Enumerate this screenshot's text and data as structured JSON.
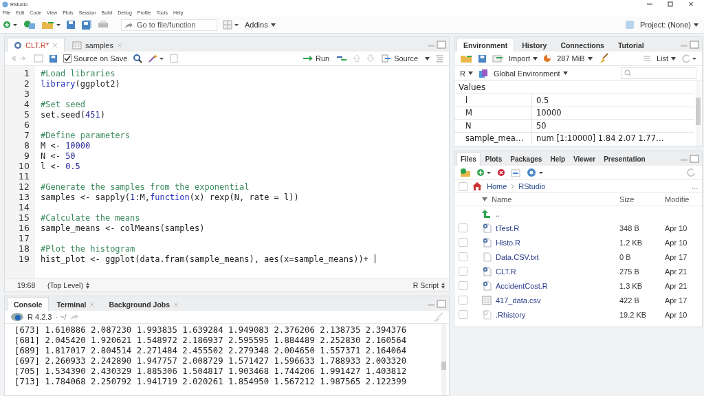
{
  "window": {
    "title": "RStudio"
  },
  "menu": [
    "File",
    "Edit",
    "Code",
    "View",
    "Plots",
    "Session",
    "Build",
    "Debug",
    "Profile",
    "Tools",
    "Help"
  ],
  "toolbar": {
    "goto_placeholder": "Go to file/function",
    "addins": "Addins",
    "project": "Project: (None)"
  },
  "editor": {
    "tabs": [
      {
        "label": "CLT.R*",
        "kind": "script",
        "selected": true,
        "modified": true
      },
      {
        "label": "samples",
        "kind": "table",
        "selected": false,
        "modified": false
      }
    ],
    "source_on_save": {
      "label": "Source on Save",
      "checked": true
    },
    "run": "Run",
    "source": "Source",
    "lines": [
      {
        "number": "1",
        "segments": [
          {
            "kind": "comment",
            "text": "#Load libraries"
          }
        ]
      },
      {
        "number": "2",
        "segments": [
          {
            "kind": "keyword",
            "text": "library"
          },
          {
            "kind": "plain",
            "text": "(ggplot2)"
          }
        ]
      },
      {
        "number": "3"
      },
      {
        "number": "4",
        "segments": [
          {
            "kind": "comment",
            "text": "#Set seed"
          }
        ]
      },
      {
        "number": "5",
        "segments": [
          {
            "kind": "plain",
            "text": "set.seed("
          },
          {
            "kind": "number",
            "text": "451"
          },
          {
            "kind": "plain",
            "text": ")"
          }
        ]
      },
      {
        "number": "6"
      },
      {
        "number": "7",
        "segments": [
          {
            "kind": "comment",
            "text": "#Define parameters"
          }
        ]
      },
      {
        "number": "8",
        "segments": [
          {
            "kind": "plain",
            "text": "M <- "
          },
          {
            "kind": "number",
            "text": "10000"
          }
        ]
      },
      {
        "number": "9",
        "segments": [
          {
            "kind": "plain",
            "text": "N <- "
          },
          {
            "kind": "number",
            "text": "50"
          }
        ]
      },
      {
        "number": "10",
        "segments": [
          {
            "kind": "plain",
            "text": "l <- "
          },
          {
            "kind": "number",
            "text": "0.5"
          }
        ]
      },
      {
        "number": "11"
      },
      {
        "number": "12",
        "segments": [
          {
            "kind": "comment",
            "text": "#Generate the samples from the exponential"
          }
        ]
      },
      {
        "number": "13",
        "segments": [
          {
            "kind": "plain",
            "text": "samples <- sapply("
          },
          {
            "kind": "number",
            "text": "1"
          },
          {
            "kind": "plain",
            "text": ":M,"
          },
          {
            "kind": "keyword",
            "text": "function"
          },
          {
            "kind": "plain",
            "text": "(x) rexp(N, rate = l))"
          }
        ]
      },
      {
        "number": "14"
      },
      {
        "number": "15",
        "segments": [
          {
            "kind": "comment",
            "text": "#Calculate the means"
          }
        ]
      },
      {
        "number": "16",
        "segments": [
          {
            "kind": "plain",
            "text": "sample_means <- colMeans(samples)"
          }
        ]
      },
      {
        "number": "17"
      },
      {
        "number": "18",
        "segments": [
          {
            "kind": "comment",
            "text": "#Plot the histogram"
          }
        ]
      },
      {
        "number": "19",
        "segments": [
          {
            "kind": "plain",
            "text": "hist_plot <- ggplot(data.fram(sample_means), aes(x=sample_means))+ "
          }
        ],
        "cursor": true
      }
    ],
    "status": {
      "position": "19:68",
      "scope": "(Top Level)",
      "file_type": "R Script"
    }
  },
  "console": {
    "tabs": [
      {
        "label": "Console",
        "selected": true,
        "closable": false
      },
      {
        "label": "Terminal",
        "selected": false,
        "closable": true
      },
      {
        "label": "Background Jobs",
        "selected": false,
        "closable": true
      }
    ],
    "version": "R 4.2.3",
    "path": "· ~/",
    "output": [
      "[673] 1.610886 2.087230 1.993835 1.639284 1.949083 2.376206 2.138735 2.394376",
      "[681] 2.045420 1.920621 1.548972 2.186937 2.595595 1.884489 2.252830 2.160564",
      "[689] 1.817017 2.804514 2.271484 2.455502 2.279348 2.004650 1.557371 2.164064",
      "[697] 2.260933 2.242890 1.947757 2.008729 1.571427 1.596633 1.788933 2.003320",
      "[705] 1.534390 2.430329 1.885306 1.504817 1.903468 1.744206 1.991427 1.403812",
      "[713] 1.784068 2.250792 1.941719 2.020261 1.854950 1.567212 1.987565 2.122399"
    ]
  },
  "environment": {
    "tabs": [
      {
        "label": "Environment",
        "selected": true
      },
      {
        "label": "History",
        "selected": false
      },
      {
        "label": "Connections",
        "selected": false
      },
      {
        "label": "Tutorial",
        "selected": false
      }
    ],
    "import": "Import",
    "memory": "287 MiB",
    "view": "List",
    "language": "R",
    "scope": "Global Environment",
    "section": "Values",
    "values": [
      {
        "name": "l",
        "value": "0.5"
      },
      {
        "name": "M",
        "value": "10000"
      },
      {
        "name": "N",
        "value": "50"
      },
      {
        "name": "sample_mea…",
        "value": "num [1:10000] 1.84 2.07 1.77…"
      }
    ]
  },
  "files": {
    "tabs": [
      {
        "label": "Files",
        "selected": true
      },
      {
        "label": "Plots",
        "selected": false
      },
      {
        "label": "Packages",
        "selected": false
      },
      {
        "label": "Help",
        "selected": false
      },
      {
        "label": "Viewer",
        "selected": false
      },
      {
        "label": "Presentation",
        "selected": false
      }
    ],
    "select_all": {
      "checked": false
    },
    "breadcrumb": [
      "Home",
      "RStudio"
    ],
    "more": "...",
    "columns": [
      "Name",
      "Size",
      "Modifie"
    ],
    "parent": "..",
    "rows": [
      {
        "kind": "r-script",
        "name": "tTest.R",
        "size": "348 B",
        "modified": "Apr 10",
        "checked": false
      },
      {
        "kind": "r-script",
        "name": "Histo.R",
        "size": "1.2 KB",
        "modified": "Apr 10",
        "checked": false
      },
      {
        "kind": "text",
        "name": "Data.CSV.txt",
        "size": "0 B",
        "modified": "Apr 17",
        "checked": false
      },
      {
        "kind": "r-script",
        "name": "CLT.R",
        "size": "275 B",
        "modified": "Apr 21",
        "checked": false
      },
      {
        "kind": "r-script",
        "name": "AccidentCost.R",
        "size": "1.3 KB",
        "modified": "Apr 21",
        "checked": false
      },
      {
        "kind": "table",
        "name": "417_data.csv",
        "size": "422 B",
        "modified": "Apr 17",
        "checked": false
      },
      {
        "kind": "history",
        "name": ".Rhistory",
        "size": "19.2 KB",
        "modified": "Apr 10",
        "checked": false
      }
    ]
  }
}
